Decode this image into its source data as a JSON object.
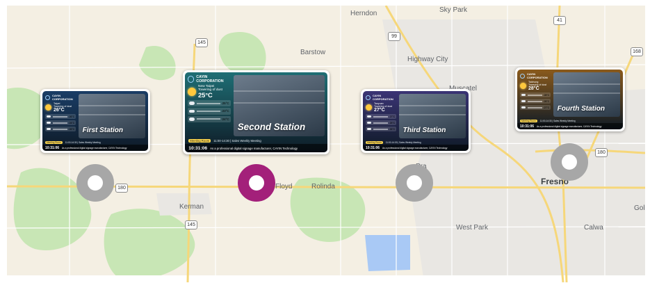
{
  "map": {
    "labels": {
      "herndon": "Herndon",
      "sky_park": "Sky Park",
      "barstow": "Barstow",
      "highway_city": "Highway City",
      "muscatel": "Muscatel",
      "kerman": "Kerman",
      "floyd": "Floyd",
      "rolinda": "Rolinda",
      "fresno": "Fresno",
      "west_park": "West Park",
      "calwa": "Calwa",
      "gold": "Gold",
      "pra": "Pra"
    },
    "shields": {
      "r99": "99",
      "r41": "41",
      "r168": "168",
      "r145_top": "145",
      "r145_bottom": "145",
      "r180_left": "180",
      "r180_right": "180"
    },
    "colors": {
      "land": "#f4efe3",
      "park": "#c8e6b5",
      "urban": "#e9e7e3",
      "water": "#a9c9f5",
      "highway": "#f6d77a",
      "road": "#ffffff"
    }
  },
  "cards": [
    {
      "company_line1": "CAYIN",
      "company_line2": "CORPORATION",
      "city": "Taipei",
      "weather_desc": "Towering of dust",
      "temp": "26°C",
      "forecast_temps": [
        "26°C",
        "24°C",
        "26°C"
      ],
      "station": "First Station",
      "time": "10:31:06",
      "ticker": "As a professional digital signage manufacturer, CAYIN Technology",
      "badge": "Meeting Room",
      "mid_text": "11:00-14:30 | Sales Weekly Meeting",
      "accent": "#1a3d66",
      "status": "inactive"
    },
    {
      "company_line1": "CAYIN",
      "company_line2": "CORPORATION",
      "city": "New Taipei",
      "weather_desc": "Towering of dust",
      "temp": "25°C",
      "forecast_temps": [
        "25°C",
        "23°C",
        "24°C"
      ],
      "station": "Second Station",
      "time": "10:31:06",
      "ticker": "As a professional digital signage manufacturer, CAYIN Technology",
      "badge": "Meeting Room",
      "mid_text": "11:00-14:30 | Sales Weekly Meeting",
      "accent": "#1f6f75",
      "status": "active"
    },
    {
      "company_line1": "CAYIN",
      "company_line2": "CORPORATION",
      "city": "Taoyuan",
      "weather_desc": "Towering of dust",
      "temp": "27°C",
      "forecast_temps": [
        "27°C",
        "25°C",
        "26°C"
      ],
      "station": "Third Station",
      "time": "10:31:06",
      "ticker": "As a professional digital signage manufacturer, CAYIN Technology",
      "badge": "Meeting Room",
      "mid_text": "11:00-14:30 | Sales Weekly Meeting",
      "accent": "#3b3475",
      "status": "inactive"
    },
    {
      "company_line1": "CAYIN",
      "company_line2": "CORPORATION",
      "city": "Taichung",
      "weather_desc": "Towering of dust",
      "temp": "28°C",
      "forecast_temps": [
        "28°C",
        "26°C",
        "27°C"
      ],
      "station": "Fourth Station",
      "time": "10:31:06",
      "ticker": "As a professional digital signage manufacturer, CAYIN Technology",
      "badge": "Meeting Room",
      "mid_text": "11:00-14:30 | Sales Weekly Meeting",
      "accent": "#8a5a1c",
      "status": "inactive"
    }
  ],
  "pin_colors": {
    "active": "#a3207a",
    "inactive": "#a7a7a7"
  }
}
